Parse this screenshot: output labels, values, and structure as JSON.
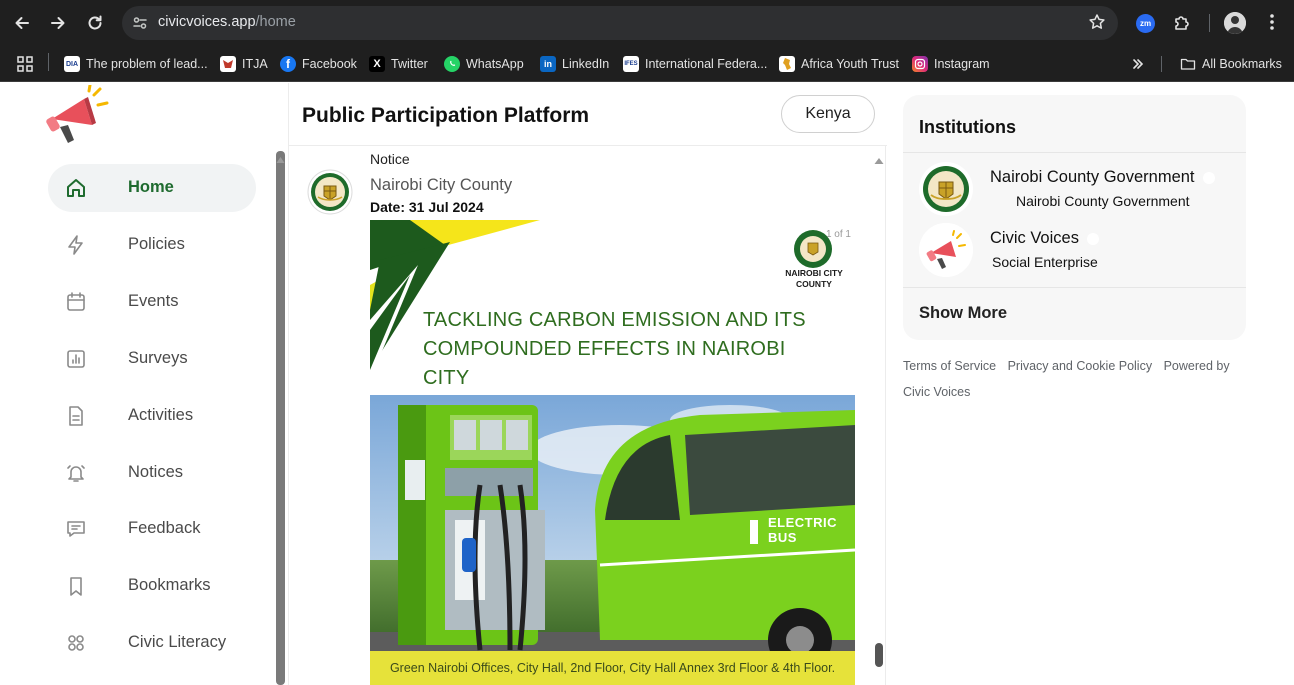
{
  "browser": {
    "url_host": "civicvoices.app",
    "url_path": "/home",
    "extension_label": "zm",
    "bookmarks": [
      {
        "label": "The problem of lead...",
        "icon": "dia-icon",
        "fav_text": "DIA"
      },
      {
        "label": "ITJA",
        "icon": "itja-icon"
      },
      {
        "label": "Facebook",
        "icon": "facebook-icon"
      },
      {
        "label": "Twitter",
        "icon": "x-icon"
      },
      {
        "label": "WhatsApp",
        "icon": "whatsapp-icon"
      },
      {
        "label": "LinkedIn",
        "icon": "linkedin-icon"
      },
      {
        "label": "International Federa...",
        "icon": "ifes-icon",
        "fav_text": "IFES"
      },
      {
        "label": "Africa Youth Trust",
        "icon": "africa-youth-trust-icon"
      },
      {
        "label": "Instagram",
        "icon": "instagram-icon"
      }
    ],
    "all_bookmarks_label": "All Bookmarks"
  },
  "sidebar": {
    "items": [
      {
        "label": "Home",
        "icon": "home-icon",
        "active": true
      },
      {
        "label": "Policies",
        "icon": "bolt-icon"
      },
      {
        "label": "Events",
        "icon": "calendar-icon"
      },
      {
        "label": "Surveys",
        "icon": "bar-chart-icon"
      },
      {
        "label": "Activities",
        "icon": "document-icon"
      },
      {
        "label": "Notices",
        "icon": "bell-icon"
      },
      {
        "label": "Feedback",
        "icon": "chat-icon"
      },
      {
        "label": "Bookmarks",
        "icon": "bookmark-icon"
      },
      {
        "label": "Civic Literacy",
        "icon": "grid-icon"
      }
    ]
  },
  "main": {
    "title": "Public Participation Platform",
    "country": "Kenya",
    "post": {
      "type": "Notice",
      "author": "Nairobi City County",
      "date": "Date: 31 Jul 2024",
      "poster": {
        "page_indicator": "1 of 1",
        "org_line1": "NAIROBI CITY",
        "org_line2": "COUNTY",
        "title_line1": "TACKLING CARBON EMISSION AND ITS",
        "title_line2": "COMPOUNDED EFFECTS IN NAIROBI",
        "title_line3": "CITY",
        "bus_label": "ELECTRIC BUS",
        "footer": "Green Nairobi Offices, City Hall, 2nd Floor, City Hall Annex 3rd Floor & 4th Floor."
      }
    }
  },
  "institutions": {
    "title": "Institutions",
    "items": [
      {
        "name": "Nairobi County Government",
        "subtitle": "Nairobi County Government"
      },
      {
        "name": "Civic Voices",
        "subtitle": "Social Enterprise"
      }
    ],
    "show_more": "Show More"
  },
  "footer": {
    "terms": "Terms of Service",
    "privacy": "Privacy and Cookie Policy",
    "powered": "Powered by Civic Voices"
  },
  "colors": {
    "accent_green": "#1f6b2f",
    "poster_green": "#6cc417",
    "poster_yellow": "#e6e23a"
  }
}
